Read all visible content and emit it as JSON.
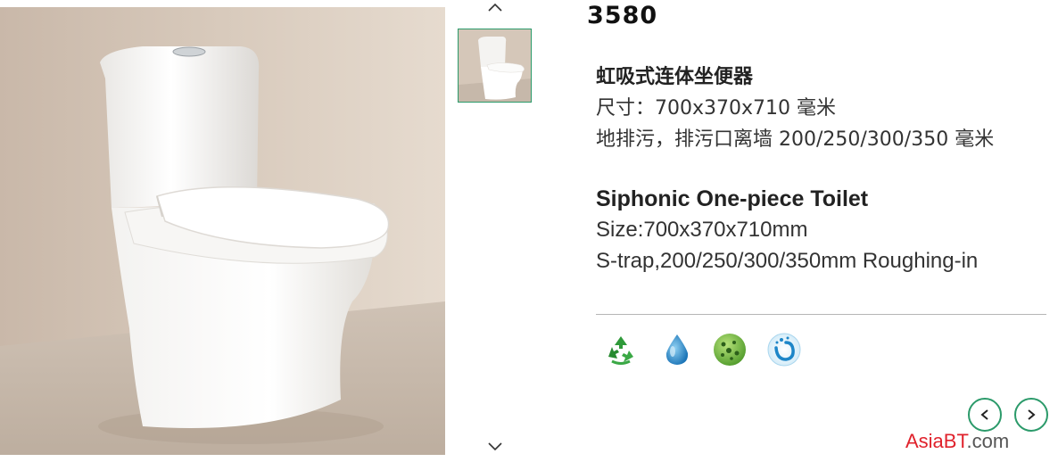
{
  "product": {
    "model": "3580",
    "cn": {
      "title": "虹吸式连体坐便器",
      "size": "尺寸：700x370x710 毫米",
      "drain": "地排污，排污口离墙 200/250/300/350 毫米"
    },
    "en": {
      "title": "Siphonic One-piece Toilet",
      "size": "Size:700x370x710mm",
      "drain": "S-trap,200/250/300/350mm Roughing-in"
    }
  },
  "gallery": {
    "up_icon": "chevron-up-icon",
    "down_icon": "chevron-down-icon",
    "selected_index": 0
  },
  "feature_icons": [
    "recycle-icon",
    "water-drop-icon",
    "antibacterial-icon",
    "water-swirl-icon"
  ],
  "navigation": {
    "prev_icon": "chevron-left-icon",
    "next_icon": "chevron-right-icon"
  },
  "watermark": {
    "brand": "AsiaBT",
    "suffix": ".com"
  },
  "colors": {
    "accent": "#2b9a6a",
    "watermark_red": "#e0222c",
    "divider": "#b5b5b5"
  }
}
